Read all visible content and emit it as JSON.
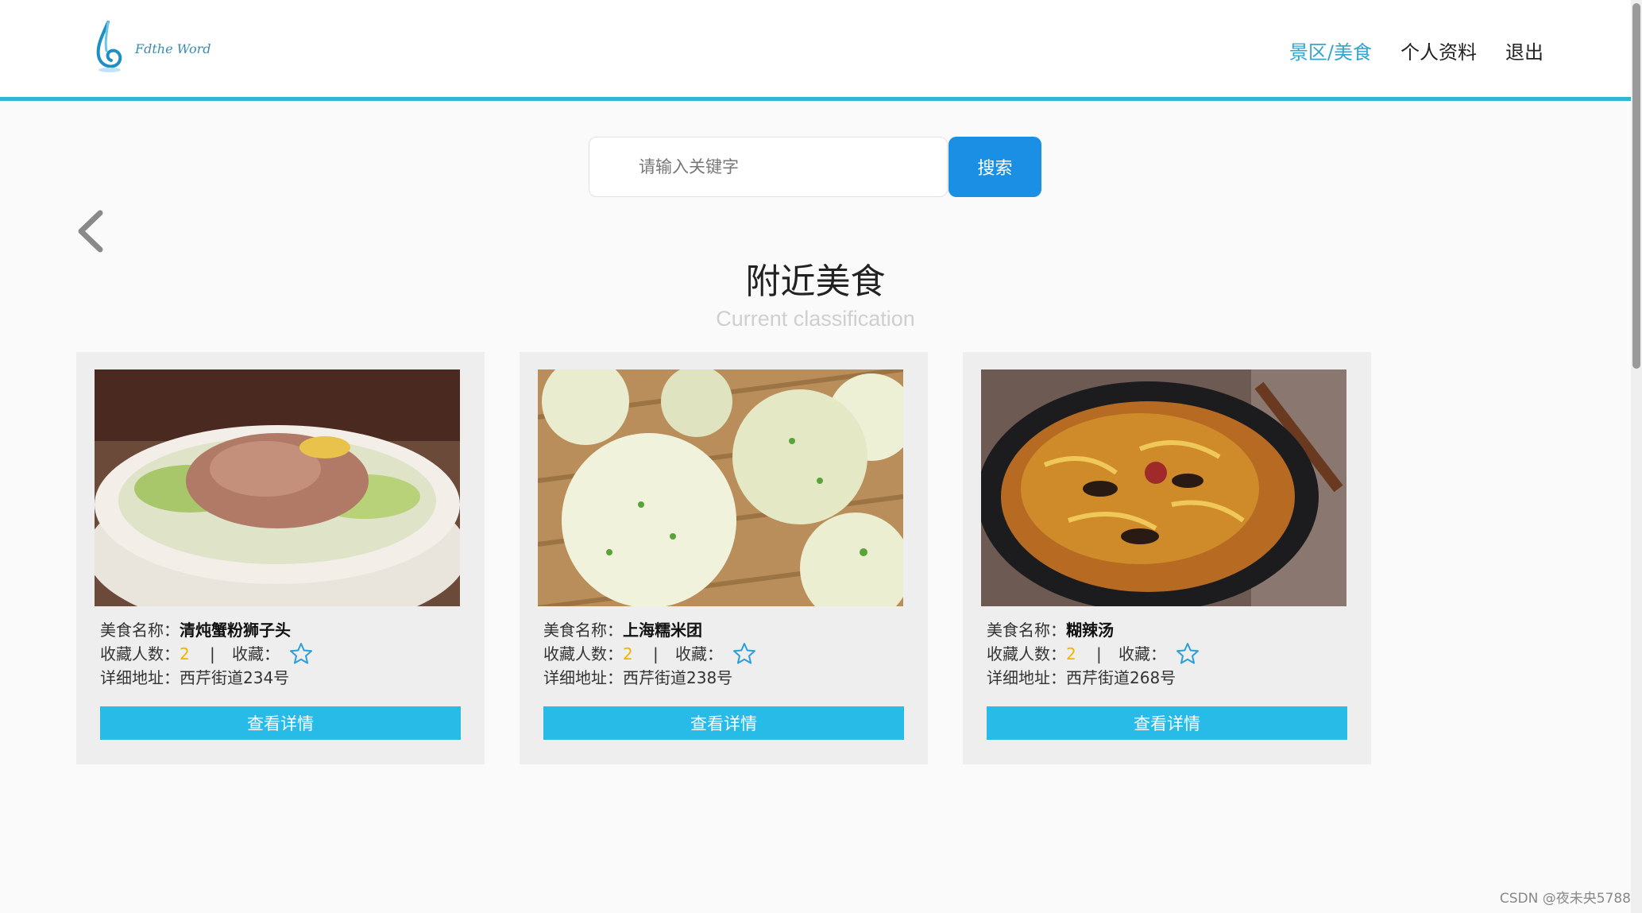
{
  "header": {
    "logo_text": "Fdthe Word",
    "nav": [
      {
        "label": "景区/美食",
        "active": true
      },
      {
        "label": "个人资料",
        "active": false
      },
      {
        "label": "退出",
        "active": false
      }
    ]
  },
  "search": {
    "placeholder": "请输入关键字",
    "button_label": "搜索"
  },
  "section": {
    "title": "附近美食",
    "subtitle": "Current classification"
  },
  "labels": {
    "name_label": "美食名称：",
    "fav_count_label": "收藏人数：",
    "separator": "|",
    "fav_label": "收藏：",
    "address_label": "详细地址：",
    "detail_button": "查看详情"
  },
  "cards": [
    {
      "name": "清炖蟹粉狮子头",
      "fav_count": "2",
      "address": "西芹街道234号",
      "image": "braised-meatball-soup"
    },
    {
      "name": "上海糯米团",
      "fav_count": "2",
      "address": "西芹街道238号",
      "image": "sticky-rice-balls"
    },
    {
      "name": "糊辣汤",
      "fav_count": "2",
      "address": "西芹街道268号",
      "image": "hot-spicy-soup"
    }
  ],
  "watermark": "CSDN @夜未央5788",
  "colors": {
    "accent": "#2fb6d4",
    "nav_active": "#2fa6d1",
    "search_button": "#1a8fe3",
    "detail_button": "#29bbe8",
    "count": "#f0b400",
    "star": "#2a9fd8"
  }
}
